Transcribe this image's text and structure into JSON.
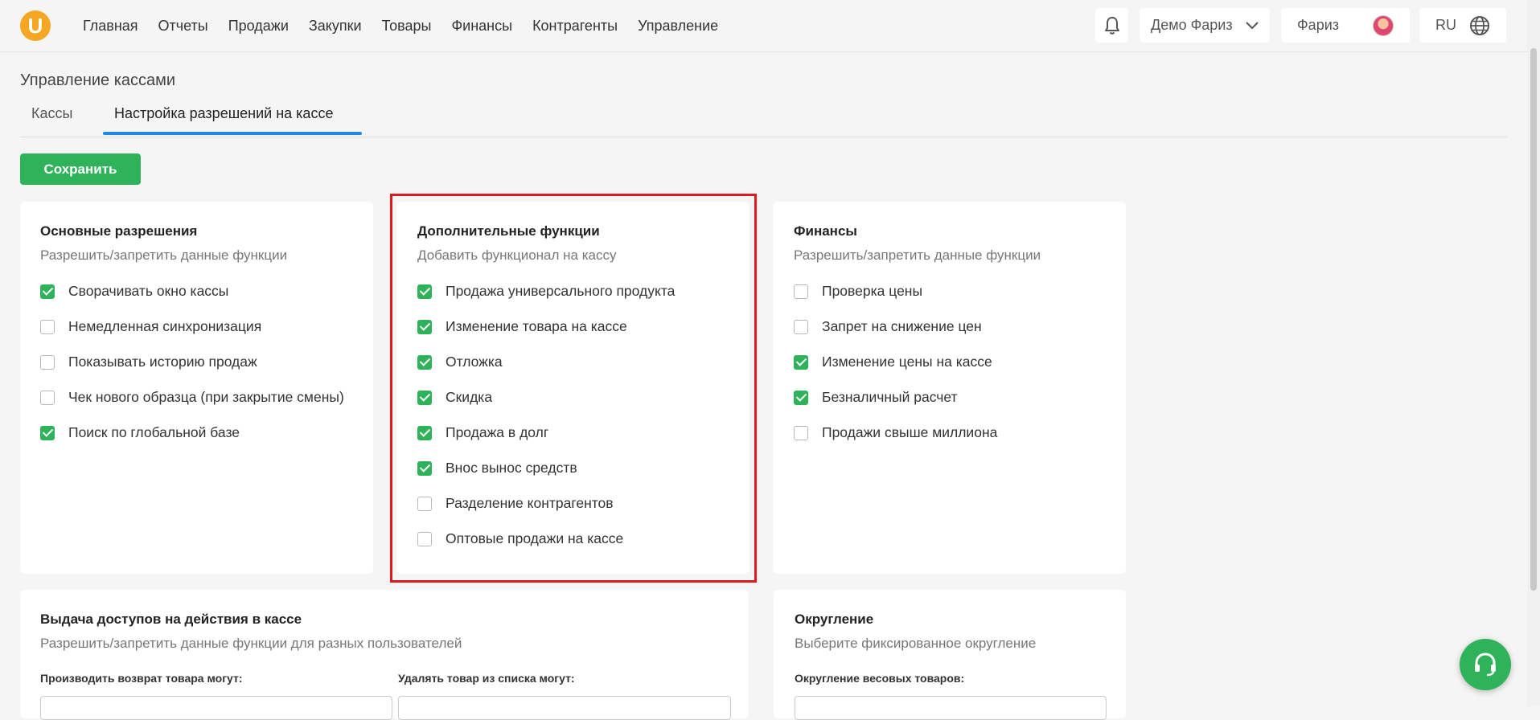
{
  "logo": {
    "letter": "U"
  },
  "nav": [
    "Главная",
    "Отчеты",
    "Продажи",
    "Закупки",
    "Товары",
    "Финансы",
    "Контрагенты",
    "Управление"
  ],
  "header": {
    "company": "Демо Фариз",
    "user": "Фариз",
    "lang": "RU"
  },
  "page": {
    "title": "Управление кассами"
  },
  "tabs": {
    "kassy": "Кассы",
    "active": "Настройка разрешений на кассе"
  },
  "save_label": "Сохранить",
  "cards": {
    "basic": {
      "title": "Основные разрешения",
      "subtitle": "Разрешить/запретить данные функции",
      "options": [
        {
          "label": "Сворачивать окно кассы",
          "checked": true
        },
        {
          "label": "Немедленная синхронизация",
          "checked": false
        },
        {
          "label": "Показывать историю продаж",
          "checked": false
        },
        {
          "label": "Чек нового образца (при закрытие смены)",
          "checked": false
        },
        {
          "label": "Поиск по глобальной базе",
          "checked": true
        }
      ]
    },
    "extra": {
      "title": "Дополнительные функции",
      "subtitle": "Добавить функционал на кассу",
      "options": [
        {
          "label": "Продажа универсального продукта",
          "checked": true
        },
        {
          "label": "Изменение товара на кассе",
          "checked": true
        },
        {
          "label": "Отложка",
          "checked": true
        },
        {
          "label": "Скидка",
          "checked": true
        },
        {
          "label": "Продажа в долг",
          "checked": true
        },
        {
          "label": "Внос вынос средств",
          "checked": true
        },
        {
          "label": "Разделение контрагентов",
          "checked": false
        },
        {
          "label": "Оптовые продажи на кассе",
          "checked": false
        }
      ]
    },
    "finance": {
      "title": "Финансы",
      "subtitle": "Разрешить/запретить данные функции",
      "options": [
        {
          "label": "Проверка цены",
          "checked": false
        },
        {
          "label": "Запрет на снижение цен",
          "checked": false
        },
        {
          "label": "Изменение цены на кассе",
          "checked": true
        },
        {
          "label": "Безналичный расчет",
          "checked": true
        },
        {
          "label": "Продажи свыше миллиона",
          "checked": false
        }
      ]
    },
    "access": {
      "title": "Выдача доступов на действия в кассе",
      "subtitle": "Разрешить/запретить данные функции для разных пользователей",
      "field1_label": "Производить возврат товара могут:",
      "field2_label": "Удалять товар из списка могут:"
    },
    "rounding": {
      "title": "Округление",
      "subtitle": "Выберите фиксированное округление",
      "field_label": "Округление весовых товаров:"
    }
  },
  "colors": {
    "accent": "#2fb35a",
    "tab_underline": "#1e88e5",
    "highlight": "#e0191f",
    "logo": "#f5a623"
  },
  "icons": [
    "bell-icon",
    "chevron-down-icon",
    "globe-icon",
    "headset-icon"
  ]
}
